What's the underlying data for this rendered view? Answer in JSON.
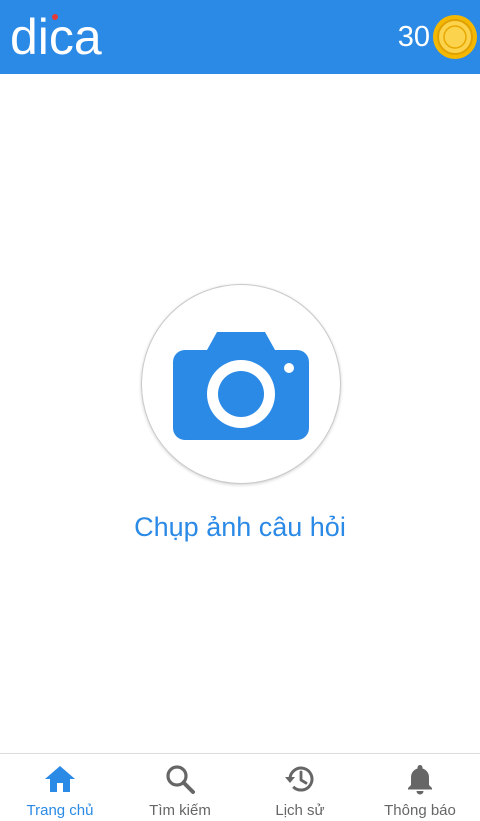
{
  "colors": {
    "primary": "#2b8ae6",
    "nav_inactive": "#666666",
    "coin": "#f5b800"
  },
  "header": {
    "logo_text": "dica",
    "coin_count": "30",
    "coin_icon": "gold-coin-icon"
  },
  "main": {
    "camera_icon": "camera-icon",
    "camera_label": "Chụp ảnh câu hỏi"
  },
  "bottom_nav": {
    "items": [
      {
        "label": "Trang chủ",
        "icon": "home-icon",
        "active": true
      },
      {
        "label": "Tìm kiếm",
        "icon": "search-icon",
        "active": false
      },
      {
        "label": "Lịch sử",
        "icon": "history-icon",
        "active": false
      },
      {
        "label": "Thông báo",
        "icon": "bell-icon",
        "active": false
      }
    ]
  }
}
